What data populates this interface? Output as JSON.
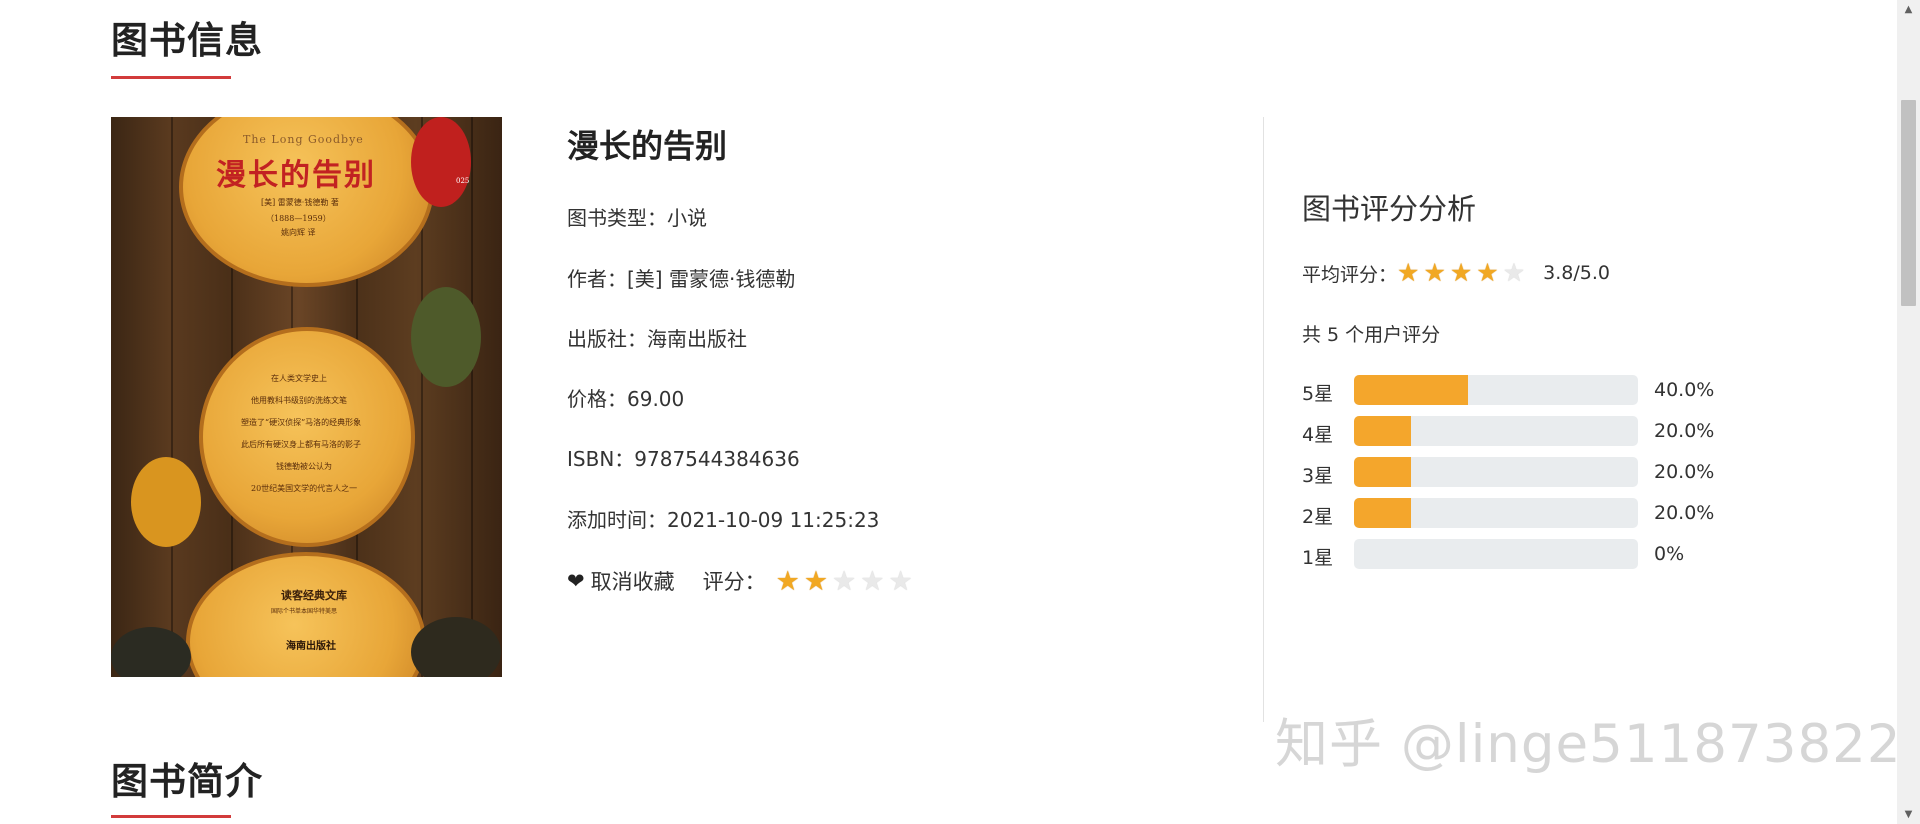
{
  "sections": {
    "info_title": "图书信息",
    "intro_title": "图书简介"
  },
  "cover": {
    "english_title": "The Long Goodbye",
    "chinese_title": "漫长的告别",
    "author_line": "[美] 雷蒙德·钱德勒 著",
    "years_line": "（1888—1959）",
    "translator_line": "姚向辉 译",
    "blurb": [
      "在人类文学史上",
      "他用教科书级别的洗练文笔",
      "塑造了“硬汉侦探”马洛的经典形象",
      "此后所有硬汉身上都有马洛的影子",
      "钱德勒被公认为",
      "20世纪美国文学的代言人之一"
    ],
    "library_name": "读客经典文库",
    "library_sub": "国际个书单本国华特美思",
    "publisher_logo": "海南出版社",
    "badge_number": "025"
  },
  "book": {
    "title": "漫长的告别",
    "type": "图书类型：小说",
    "author": "作者：[美] 雷蒙德·钱德勒",
    "publisher": "出版社：海南出版社",
    "price": "价格：69.00",
    "isbn": "ISBN：9787544384636",
    "added_time": "添加时间：2021-10-09 11:25:23"
  },
  "actions": {
    "favorite_label": "取消收藏",
    "rate_label": "评分：",
    "user_rating": 2,
    "max_rating": 5
  },
  "rating_panel": {
    "title": "图书评分分析",
    "avg_label": "平均评分：",
    "avg_stars": 4,
    "avg_value": "3.8/5.0",
    "total_label": "共 5 个用户评分",
    "bars": [
      {
        "label": "5星",
        "percent": 40.0,
        "text": "40.0%"
      },
      {
        "label": "4星",
        "percent": 20.0,
        "text": "20.0%"
      },
      {
        "label": "3星",
        "percent": 20.0,
        "text": "20.0%"
      },
      {
        "label": "2星",
        "percent": 20.0,
        "text": "20.0%"
      },
      {
        "label": "1星",
        "percent": 0,
        "text": "0%"
      }
    ]
  },
  "watermark": "知乎 @linge511873822",
  "colors": {
    "accent_red": "#d23b3b",
    "bar_orange": "#f4a62c",
    "star_gold": "#f1a823"
  }
}
